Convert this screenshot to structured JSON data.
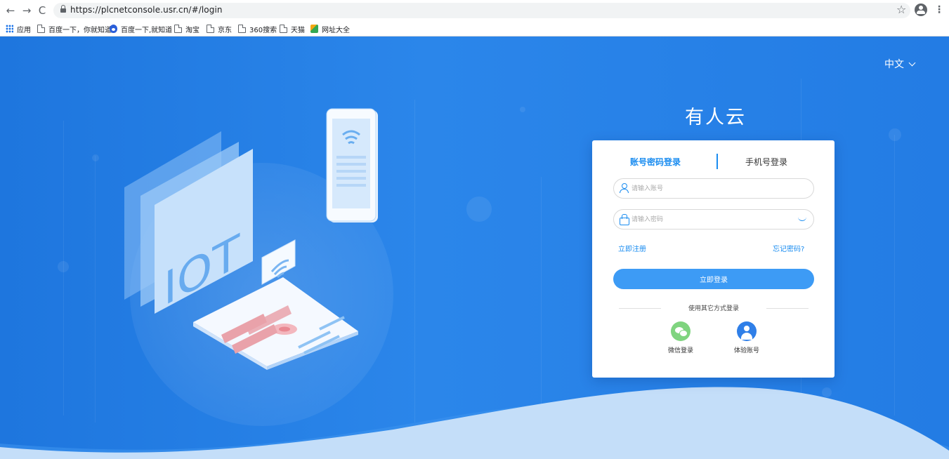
{
  "browser": {
    "url": "https://plcnetconsole.usr.cn/#/login",
    "back": "←",
    "forward": "→",
    "reload": "C",
    "star": "☆",
    "menu": "⋮"
  },
  "bookmarks": [
    {
      "label": "应用",
      "icon": "apps-icon"
    },
    {
      "label": "百度一下，你就知道",
      "icon": "page-icon"
    },
    {
      "label": "百度一下,就知道",
      "icon": "baidu-paw-icon"
    },
    {
      "label": "淘宝",
      "icon": "page-icon"
    },
    {
      "label": "京东",
      "icon": "page-icon"
    },
    {
      "label": "360搜索",
      "icon": "page-icon"
    },
    {
      "label": "天猫",
      "icon": "page-icon"
    },
    {
      "label": "网址大全",
      "icon": "web-directory-icon"
    }
  ],
  "page": {
    "language": "中文",
    "brand": "有人云",
    "illustration_text": "IOT"
  },
  "login": {
    "tab_account": "账号密码登录",
    "tab_phone": "手机号登录",
    "account_placeholder": "请输入账号",
    "password_placeholder": "请输入密码",
    "register": "立即注册",
    "forgot": "忘记密码?",
    "submit": "立即登录",
    "other_methods": "使用其它方式登录",
    "wechat": "微信登录",
    "trial": "体验账号"
  },
  "colors": {
    "background": "#2580e6",
    "accent": "#1a8cf0",
    "button": "#3d9bf5",
    "wechat": "#7fd47f"
  }
}
